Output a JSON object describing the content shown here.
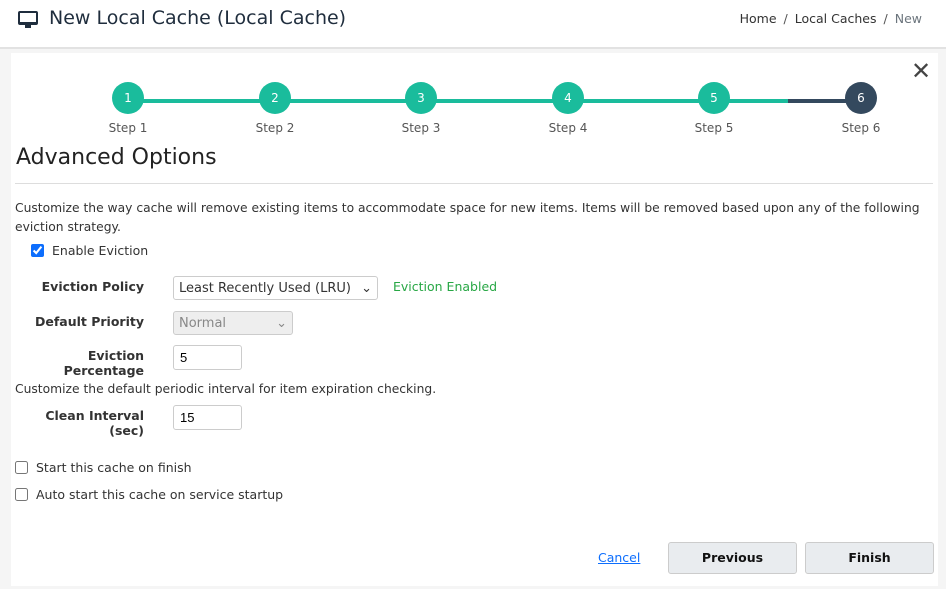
{
  "header": {
    "title": "New Local Cache (Local Cache)",
    "icon": "monitor-icon",
    "breadcrumbs": [
      "Home",
      "Local Caches",
      "New"
    ]
  },
  "wizard": {
    "steps": [
      {
        "num": "1",
        "label": "Step 1"
      },
      {
        "num": "2",
        "label": "Step 2"
      },
      {
        "num": "3",
        "label": "Step 3"
      },
      {
        "num": "4",
        "label": "Step 4"
      },
      {
        "num": "5",
        "label": "Step 5"
      },
      {
        "num": "6",
        "label": "Step 6"
      }
    ],
    "current_step": 6,
    "completed_color": "#1abc9c",
    "active_color": "#34495e"
  },
  "section": {
    "title": "Advanced Options",
    "description": "Customize the way cache will remove existing items to accommodate space for new items. Items will be removed based upon any of the following eviction strategy."
  },
  "eviction": {
    "enable_label": "Enable Eviction",
    "enabled": true,
    "policy_label": "Eviction Policy",
    "policy_value": "Least Recently Used (LRU)",
    "status": "Eviction Enabled",
    "priority_label": "Default Priority",
    "priority_value": "Normal",
    "percentage_label": "Eviction Percentage",
    "percentage_value": "5"
  },
  "expiration": {
    "description": "Customize the default periodic interval for item expiration checking.",
    "interval_label": "Clean Interval (sec)",
    "interval_value": "15"
  },
  "options": {
    "start_on_finish": "Start this cache on finish",
    "auto_start": "Auto start this cache on service startup"
  },
  "actions": {
    "cancel": "Cancel",
    "previous": "Previous",
    "finish": "Finish"
  }
}
